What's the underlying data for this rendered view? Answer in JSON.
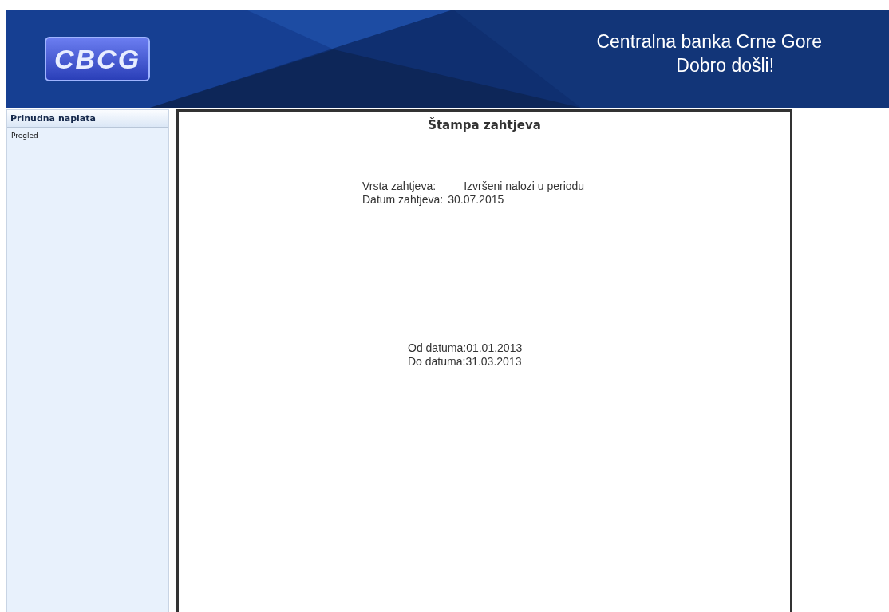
{
  "header": {
    "logo": "CBCG",
    "title": "Centralna banka Crne Gore",
    "subtitle": "Dobro došli!"
  },
  "sidebar": {
    "section": "Prinudna naplata",
    "items": [
      {
        "label": "Pregled"
      }
    ]
  },
  "document": {
    "title": "Štampa zahtjeva",
    "request_fields": [
      {
        "label": "Vrsta zahtjeva:",
        "value": "Izvršeni nalozi u periodu"
      },
      {
        "label": "Datum zahtjeva:",
        "value": "30.07.2015"
      }
    ],
    "period_fields": [
      {
        "label": "Od datuma:",
        "value": "01.01.2013"
      },
      {
        "label": "Do datuma:",
        "value": "31.03.2013"
      }
    ]
  }
}
